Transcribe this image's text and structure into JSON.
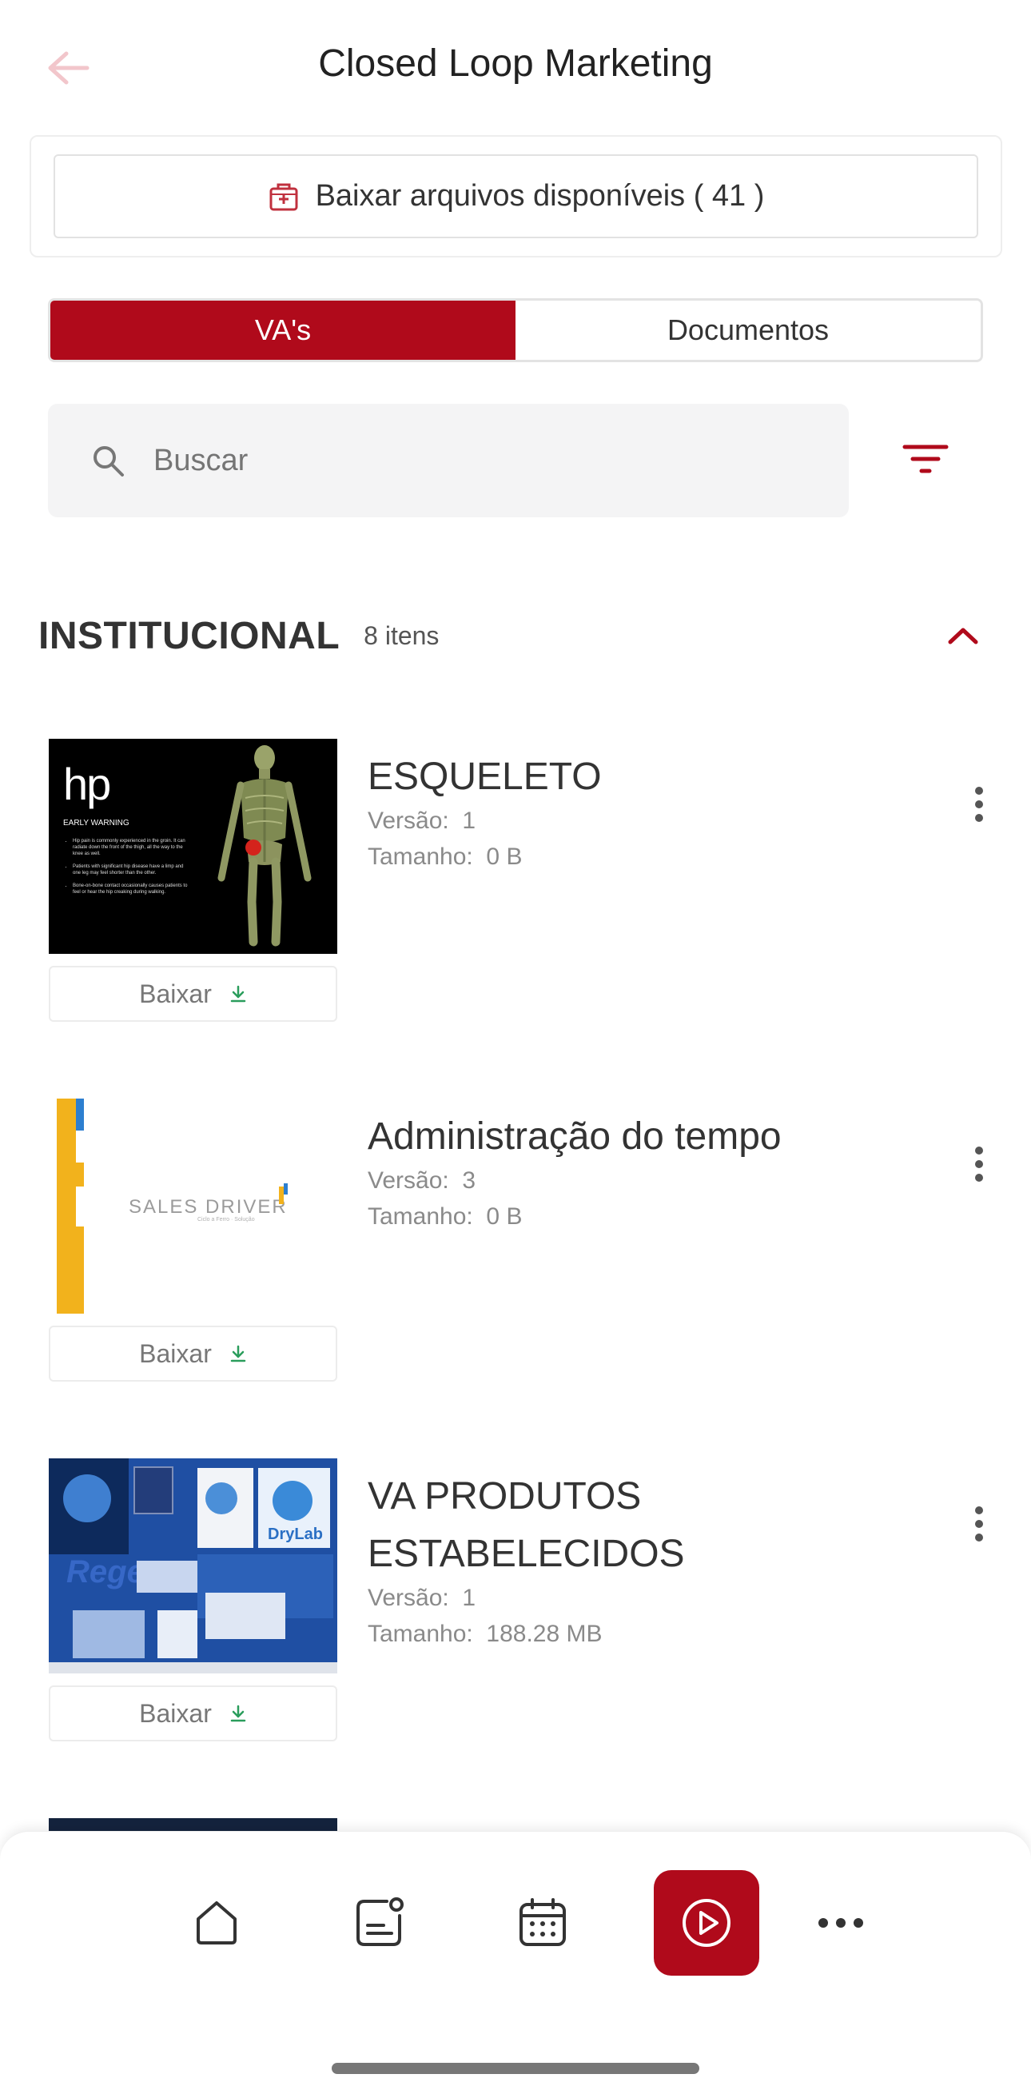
{
  "header": {
    "title": "Closed Loop Marketing",
    "back_icon": "arrow-left-icon"
  },
  "download_all": {
    "label": "Baixar arquivos disponíveis ( 41 )",
    "icon": "medical-kit-icon"
  },
  "segments": [
    {
      "label": "VA's",
      "active": true
    },
    {
      "label": "Documentos",
      "active": false
    }
  ],
  "search": {
    "placeholder": "Buscar",
    "value": ""
  },
  "filter_icon": "filter-icon",
  "section": {
    "title": "INSTITUCIONAL",
    "count": "8 itens",
    "collapse_icon": "chevron-up-icon"
  },
  "items": [
    {
      "name": "ESQUELETO",
      "version_label": "Versão:",
      "version": "1",
      "size_label": "Tamanho:",
      "size": "0 B",
      "download_label": "Baixar",
      "thumb_text": {
        "logo": "hp",
        "heading": "EARLY WARNING",
        "bullets": [
          "Hip pain is commonly experienced in the groin. It can radiate down the front of the thigh, all the way to the knee as well.",
          "Patients with significant hip disease have a limp and one leg may feel shorter than the other.",
          "Bone-on-bone contact occasionally causes patients to feel or hear the hip creaking during walking."
        ]
      }
    },
    {
      "name": "Administração do tempo",
      "version_label": "Versão:",
      "version": "3",
      "size_label": "Tamanho:",
      "size": "0 B",
      "download_label": "Baixar",
      "thumb_text": {
        "logo": "SALES DRIVER",
        "sub": "Ciclo a Ferro · Solução"
      }
    },
    {
      "name": "VA PRODUTOS ESTABELECIDOS",
      "version_label": "Versão:",
      "version": "1",
      "size_label": "Tamanho:",
      "size": "188.28 MB",
      "download_label": "Baixar",
      "thumb_text": {
        "brand1": "DryLab",
        "brand2": "Regen"
      }
    }
  ],
  "tabbar": [
    {
      "name": "home-icon",
      "active": false
    },
    {
      "name": "notes-icon",
      "active": false
    },
    {
      "name": "calendar-icon",
      "active": false
    },
    {
      "name": "play-icon",
      "active": true
    },
    {
      "name": "more-icon",
      "active": false
    }
  ],
  "colors": {
    "accent": "#b00a1b",
    "text": "#333333",
    "muted": "#8a8a8a",
    "download_green": "#2a9d5c"
  }
}
